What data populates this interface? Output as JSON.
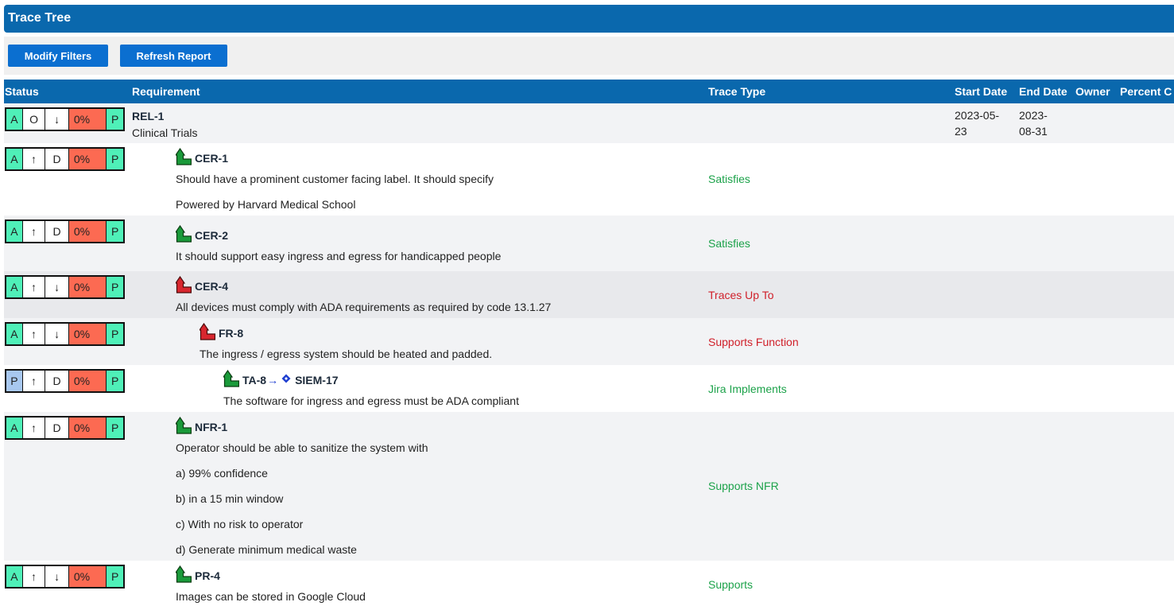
{
  "title": "Trace Tree",
  "toolbar": {
    "modify_label": "Modify Filters",
    "refresh_label": "Refresh Report"
  },
  "columns": {
    "status": "Status",
    "requirement": "Requirement",
    "trace_type": "Trace Type",
    "start_date": "Start Date",
    "end_date": "End Date",
    "owner": "Owner",
    "percent": "Percent C"
  },
  "colors": {
    "header": "#0a68ad",
    "button": "#0b6fd0",
    "green_cell": "#4ff0b8",
    "red_cell": "#fc6a52",
    "blue_cell": "#a8c8f0"
  },
  "rows": [
    {
      "status": [
        "A",
        "O",
        "↓",
        "0%",
        "P"
      ],
      "key": "REL-1",
      "lines": [
        "Clinical Trials"
      ],
      "trace_type": "",
      "start_date": [
        "2023-05-",
        "23"
      ],
      "end_date": [
        "2023-",
        "08-31"
      ],
      "icon": ""
    },
    {
      "status": [
        "A",
        "↑",
        "D",
        "0%",
        "P"
      ],
      "key": "CER-1",
      "lines": [
        "Should have a prominent customer facing label. It should specify",
        "Powered by Harvard Medical School"
      ],
      "trace_type": "Satisfies",
      "icon": "trace-up-green-icon"
    },
    {
      "status": [
        "A",
        "↑",
        "D",
        "0%",
        "P"
      ],
      "key": "CER-2",
      "lines": [
        "It should support easy ingress and egress for handicapped people"
      ],
      "trace_type": "Satisfies",
      "icon": "trace-up-green-icon"
    },
    {
      "status": [
        "A",
        "↑",
        "↓",
        "0%",
        "P"
      ],
      "key": "CER-4",
      "lines": [
        "All devices must comply with ADA requirements as required by code 13.1.27"
      ],
      "trace_type": "Traces Up To",
      "icon": "trace-up-red-icon"
    },
    {
      "status": [
        "A",
        "↑",
        "↓",
        "0%",
        "P"
      ],
      "key": "FR-8",
      "lines": [
        "The ingress / egress system should be heated and padded."
      ],
      "trace_type": "Supports Function",
      "icon": "trace-up-red-icon"
    },
    {
      "status": [
        "P",
        "↑",
        "D",
        "0%",
        "P"
      ],
      "key": "TA-8",
      "linked_key": "SIEM-17",
      "lines": [
        "The software for ingress and egress must be ADA compliant"
      ],
      "trace_type": "Jira Implements",
      "icon": "trace-up-green-icon"
    },
    {
      "status": [
        "A",
        "↑",
        "D",
        "0%",
        "P"
      ],
      "key": "NFR-1",
      "lines": [
        "Operator should be able to sanitize the system with",
        "a) 99% confidence",
        "b) in a 15 min window",
        "c) With no risk to operator",
        "d) Generate minimum medical waste"
      ],
      "trace_type": "Supports NFR",
      "icon": "trace-up-green-icon"
    },
    {
      "status": [
        "A",
        "↑",
        "↓",
        "0%",
        "P"
      ],
      "key": "PR-4",
      "lines": [
        "Images can be stored in Google Cloud"
      ],
      "trace_type": "Supports",
      "icon": "trace-up-green-icon"
    }
  ]
}
